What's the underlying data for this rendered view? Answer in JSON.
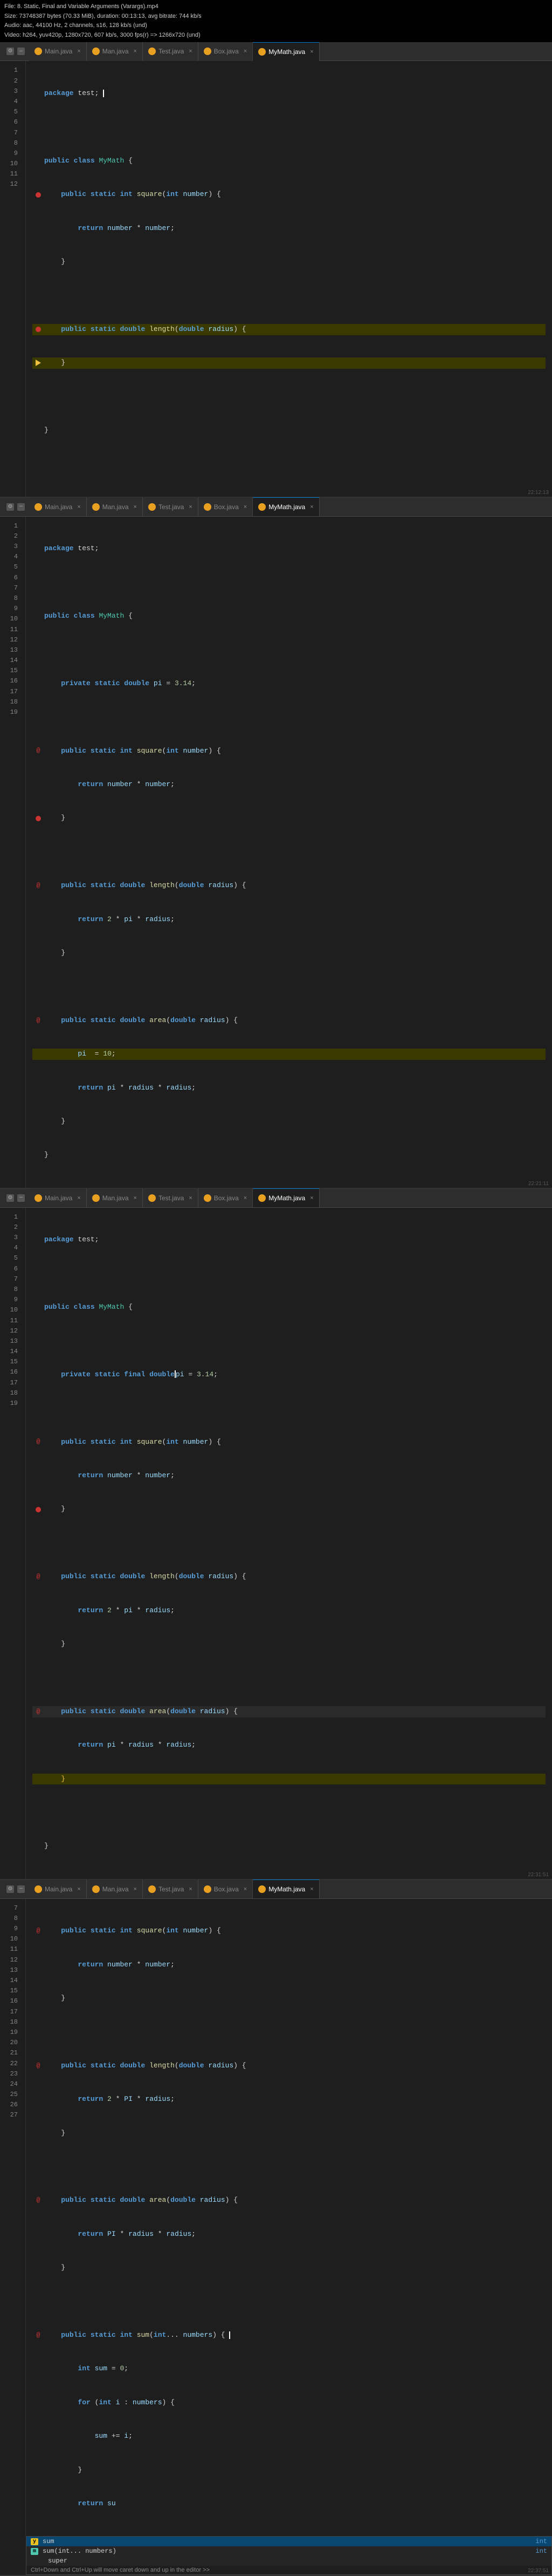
{
  "file_info": {
    "line1": "File: 8. Static, Final and Variable Arguments (Varargs).mp4",
    "line2": "Size: 73748387 bytes (70.33 MiB), duration: 00:13:13, avg bitrate: 744 kb/s",
    "line3": "Audio: aac, 44100 Hz, 2 channels, s16, 128 kb/s (und)",
    "line4": "Video: h264, yuv420p, 1280x720, 607 kb/s, 3000 fps(r) => 1266x720 (und)"
  },
  "tabs": [
    {
      "id": "main",
      "label": "Main.java",
      "active": false
    },
    {
      "id": "man",
      "label": "Man.java",
      "active": false
    },
    {
      "id": "test",
      "label": "Test.java",
      "active": false
    },
    {
      "id": "box",
      "label": "Box.java",
      "active": false
    },
    {
      "id": "mymath",
      "label": "MyMath.java",
      "active": true
    }
  ],
  "panels": {
    "panel1": {
      "timestamp": "22:12:13",
      "code": [
        {
          "ln": "1",
          "gutter": "",
          "text": "package test;"
        },
        {
          "ln": "2",
          "gutter": "",
          "text": ""
        },
        {
          "ln": "3",
          "gutter": "",
          "text": "public class MyMath {"
        },
        {
          "ln": "4",
          "gutter": "bp",
          "text": "    public static int square(int number) {"
        },
        {
          "ln": "5",
          "gutter": "",
          "text": "        return number * number;"
        },
        {
          "ln": "6",
          "gutter": "",
          "text": "    }"
        },
        {
          "ln": "7",
          "gutter": "",
          "text": ""
        },
        {
          "ln": "8",
          "gutter": "bp",
          "text": "    public static double length(double radius) {"
        },
        {
          "ln": "9",
          "gutter": "arrow",
          "text": "    }"
        },
        {
          "ln": "10",
          "gutter": "",
          "text": ""
        },
        {
          "ln": "11",
          "gutter": "",
          "text": "}"
        },
        {
          "ln": "12",
          "gutter": "",
          "text": ""
        }
      ]
    },
    "panel2": {
      "timestamp": "22:21:11",
      "code": [
        {
          "ln": "1",
          "gutter": "",
          "text": "package test;"
        },
        {
          "ln": "2",
          "gutter": "",
          "text": ""
        },
        {
          "ln": "3",
          "gutter": "",
          "text": "public class MyMath {"
        },
        {
          "ln": "4",
          "gutter": "",
          "text": ""
        },
        {
          "ln": "5",
          "gutter": "",
          "text": "    private static double pi = 3.14;"
        },
        {
          "ln": "6",
          "gutter": "",
          "text": ""
        },
        {
          "ln": "7",
          "gutter": "at",
          "text": "    public static int square(int number) {"
        },
        {
          "ln": "8",
          "gutter": "",
          "text": "        return number * number;"
        },
        {
          "ln": "9",
          "gutter": "bp",
          "text": "    }"
        },
        {
          "ln": "10",
          "gutter": "",
          "text": ""
        },
        {
          "ln": "11",
          "gutter": "at",
          "text": "    public static double length(double radius) {"
        },
        {
          "ln": "12",
          "gutter": "",
          "text": "        return 2 * pi * radius;"
        },
        {
          "ln": "13",
          "gutter": "",
          "text": "    }"
        },
        {
          "ln": "14",
          "gutter": "",
          "text": ""
        },
        {
          "ln": "15",
          "gutter": "at",
          "text": "    public static double area(double radius) {"
        },
        {
          "ln": "16",
          "gutter": "yellow",
          "text": "        pi  = 10;"
        },
        {
          "ln": "17",
          "gutter": "",
          "text": "        return pi * radius * radius;"
        },
        {
          "ln": "18",
          "gutter": "",
          "text": "    }"
        },
        {
          "ln": "19",
          "gutter": "",
          "text": "}"
        }
      ]
    },
    "panel3": {
      "timestamp": "22:31:51",
      "code": [
        {
          "ln": "1",
          "gutter": "",
          "text": "package test;"
        },
        {
          "ln": "2",
          "gutter": "",
          "text": ""
        },
        {
          "ln": "3",
          "gutter": "",
          "text": "public class MyMath {"
        },
        {
          "ln": "4",
          "gutter": "",
          "text": ""
        },
        {
          "ln": "5",
          "gutter": "",
          "text": "    private static final double pi = 3.14;"
        },
        {
          "ln": "6",
          "gutter": "",
          "text": ""
        },
        {
          "ln": "7",
          "gutter": "at",
          "text": "    public static int square(int number) {"
        },
        {
          "ln": "8",
          "gutter": "",
          "text": "        return number * number;"
        },
        {
          "ln": "9",
          "gutter": "bp",
          "text": "    }"
        },
        {
          "ln": "10",
          "gutter": "",
          "text": ""
        },
        {
          "ln": "11",
          "gutter": "at",
          "text": "    public static double length(double radius) {"
        },
        {
          "ln": "12",
          "gutter": "",
          "text": "        return 2 * pi * radius;"
        },
        {
          "ln": "13",
          "gutter": "",
          "text": "    }"
        },
        {
          "ln": "14",
          "gutter": "",
          "text": ""
        },
        {
          "ln": "15",
          "gutter": "at",
          "text": "    public static double area(double radius) {"
        },
        {
          "ln": "16",
          "gutter": "",
          "text": "        return pi * radius * radius;"
        },
        {
          "ln": "17",
          "gutter": "yellow",
          "text": "    }"
        },
        {
          "ln": "18",
          "gutter": "",
          "text": ""
        },
        {
          "ln": "19",
          "gutter": "",
          "text": "}"
        }
      ]
    },
    "panel4": {
      "timestamp": "22:37:51",
      "code": [
        {
          "ln": "7",
          "gutter": "at",
          "text": "    public static int square(int number) {"
        },
        {
          "ln": "8",
          "gutter": "",
          "text": "        return number * number;"
        },
        {
          "ln": "9",
          "gutter": "",
          "text": "    }"
        },
        {
          "ln": "10",
          "gutter": "",
          "text": ""
        },
        {
          "ln": "11",
          "gutter": "at",
          "text": "    public static double length(double radius) {"
        },
        {
          "ln": "12",
          "gutter": "",
          "text": "        return 2 * PI * radius;"
        },
        {
          "ln": "13",
          "gutter": "",
          "text": "    }"
        },
        {
          "ln": "14",
          "gutter": "",
          "text": ""
        },
        {
          "ln": "15",
          "gutter": "at",
          "text": "    public static double area(double radius) {"
        },
        {
          "ln": "16",
          "gutter": "",
          "text": "        return PI * radius * radius;"
        },
        {
          "ln": "17",
          "gutter": "",
          "text": "    }"
        },
        {
          "ln": "18",
          "gutter": "",
          "text": ""
        },
        {
          "ln": "19",
          "gutter": "at",
          "text": "    public static int sum(int... numbers) {"
        },
        {
          "ln": "20",
          "gutter": "",
          "text": "        int sum = 0;"
        },
        {
          "ln": "21",
          "gutter": "",
          "text": "        for (int i : numbers) {"
        },
        {
          "ln": "22",
          "gutter": "",
          "text": "            sum += i;"
        },
        {
          "ln": "23",
          "gutter": "",
          "text": "        }"
        },
        {
          "ln": "24",
          "gutter": "",
          "text": "        return su"
        },
        {
          "ln": "25",
          "gutter": "",
          "text": "    }"
        },
        {
          "ln": "26",
          "gutter": "",
          "text": "}"
        },
        {
          "ln": "27",
          "gutter": "",
          "text": ""
        }
      ],
      "autocomplete": {
        "items": [
          {
            "icon": "y",
            "label": "sum",
            "type": "int",
            "selected": true
          },
          {
            "icon": "g",
            "label": "sum(int... numbers)",
            "type": "int",
            "selected": false
          },
          {
            "icon": "",
            "label": "super",
            "type": "",
            "selected": false
          }
        ],
        "hint": "Ctrl+Down and Ctrl+Up will move caret down and up in the editor  >>"
      }
    }
  },
  "colors": {
    "keyword": "#569cd6",
    "type": "#4ec9b0",
    "method": "#dcdcaa",
    "string": "#ce9178",
    "number": "#b5cea8",
    "variable": "#9cdcfe",
    "bg": "#1e1e1e",
    "active_tab_top": "#007acc",
    "breakpoint": "#cc3333"
  }
}
